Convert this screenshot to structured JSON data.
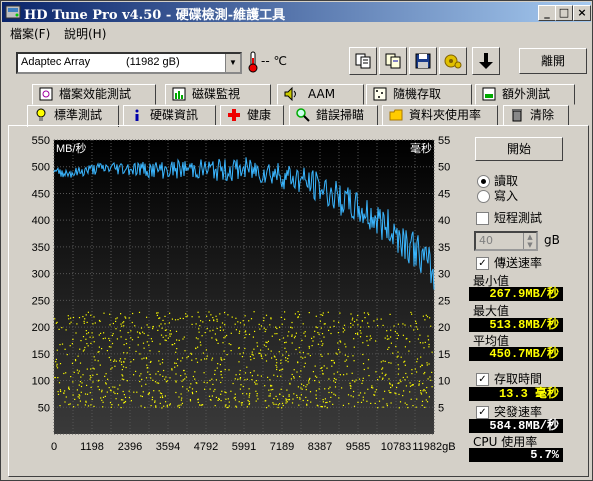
{
  "window": {
    "title": "HD Tune Pro v4.50 - 硬碟檢測-維護工具"
  },
  "menu": [
    "檔案(F)",
    "說明(H)"
  ],
  "toolbar": {
    "drive_name": "Adaptec Array",
    "drive_size": "(11982 gB)",
    "temp": "-- ℃",
    "exit_label": "離開"
  },
  "tabs_row1": [
    {
      "label": "檔案效能測試",
      "icon": "file-benchmark-icon"
    },
    {
      "label": "磁碟監視",
      "icon": "disk-monitor-icon"
    },
    {
      "label": "AAM",
      "icon": "speaker-icon"
    },
    {
      "label": "隨機存取",
      "icon": "random-access-icon"
    },
    {
      "label": "額外測試",
      "icon": "extra-tests-icon"
    }
  ],
  "tabs_row2": [
    {
      "label": "標準測試",
      "icon": "benchmark-icon"
    },
    {
      "label": "硬碟資訊",
      "icon": "info-icon"
    },
    {
      "label": "健康",
      "icon": "health-icon"
    },
    {
      "label": "錯誤掃瞄",
      "icon": "magnifier-icon"
    },
    {
      "label": "資料夾使用率",
      "icon": "folder-icon"
    },
    {
      "label": "清除",
      "icon": "trash-icon"
    }
  ],
  "chart_data": {
    "type": "scatter",
    "y_left_label": "MB/秒",
    "y_right_label": "毫秒",
    "y_left_ticks": [
      550,
      500,
      450,
      400,
      350,
      300,
      250,
      200,
      150,
      100,
      50
    ],
    "y_right_ticks": [
      55,
      50,
      45,
      40,
      35,
      30,
      25,
      20,
      15,
      10,
      5
    ],
    "x_ticks": [
      "0",
      "1198",
      "2396",
      "3594",
      "4792",
      "5991",
      "7189",
      "8387",
      "9585",
      "10783",
      "11982gB"
    ],
    "ylim_left": [
      0,
      550
    ],
    "ylim_right": [
      0,
      55
    ],
    "transfer_rate_points": [
      [
        0,
        490
      ],
      [
        600,
        488
      ],
      [
        1200,
        495
      ],
      [
        1800,
        498
      ],
      [
        2400,
        497
      ],
      [
        3000,
        495
      ],
      [
        3600,
        494
      ],
      [
        4200,
        496
      ],
      [
        4800,
        495
      ],
      [
        5400,
        493
      ],
      [
        6000,
        495
      ],
      [
        6600,
        492
      ],
      [
        7200,
        485
      ],
      [
        7800,
        475
      ],
      [
        8400,
        460
      ],
      [
        9000,
        440
      ],
      [
        9600,
        420
      ],
      [
        10200,
        400
      ],
      [
        10800,
        375
      ],
      [
        11400,
        345
      ],
      [
        11982,
        300
      ]
    ],
    "access_time_range_ms": [
      5,
      23
    ],
    "series": [
      {
        "name": "傳送速率",
        "color": "#3ab6ff"
      },
      {
        "name": "存取時間",
        "color": "#ffff00"
      }
    ]
  },
  "side": {
    "start_label": "開始",
    "read_label": "讀取",
    "write_label": "寫入",
    "short_test_label": "短程測試",
    "short_value": "40",
    "short_unit": "gB",
    "transfer_label": "傳送速率",
    "min_label": "最小值",
    "min_value": "267.9MB/秒",
    "max_label": "最大值",
    "max_value": "513.8MB/秒",
    "avg_label": "平均值",
    "avg_value": "450.7MB/秒",
    "access_label": "存取時間",
    "access_value": "13.3 毫秒",
    "burst_label": "突發速率",
    "burst_value": "584.8MB/秒",
    "cpu_label": "CPU 使用率",
    "cpu_value": "5.7%"
  }
}
